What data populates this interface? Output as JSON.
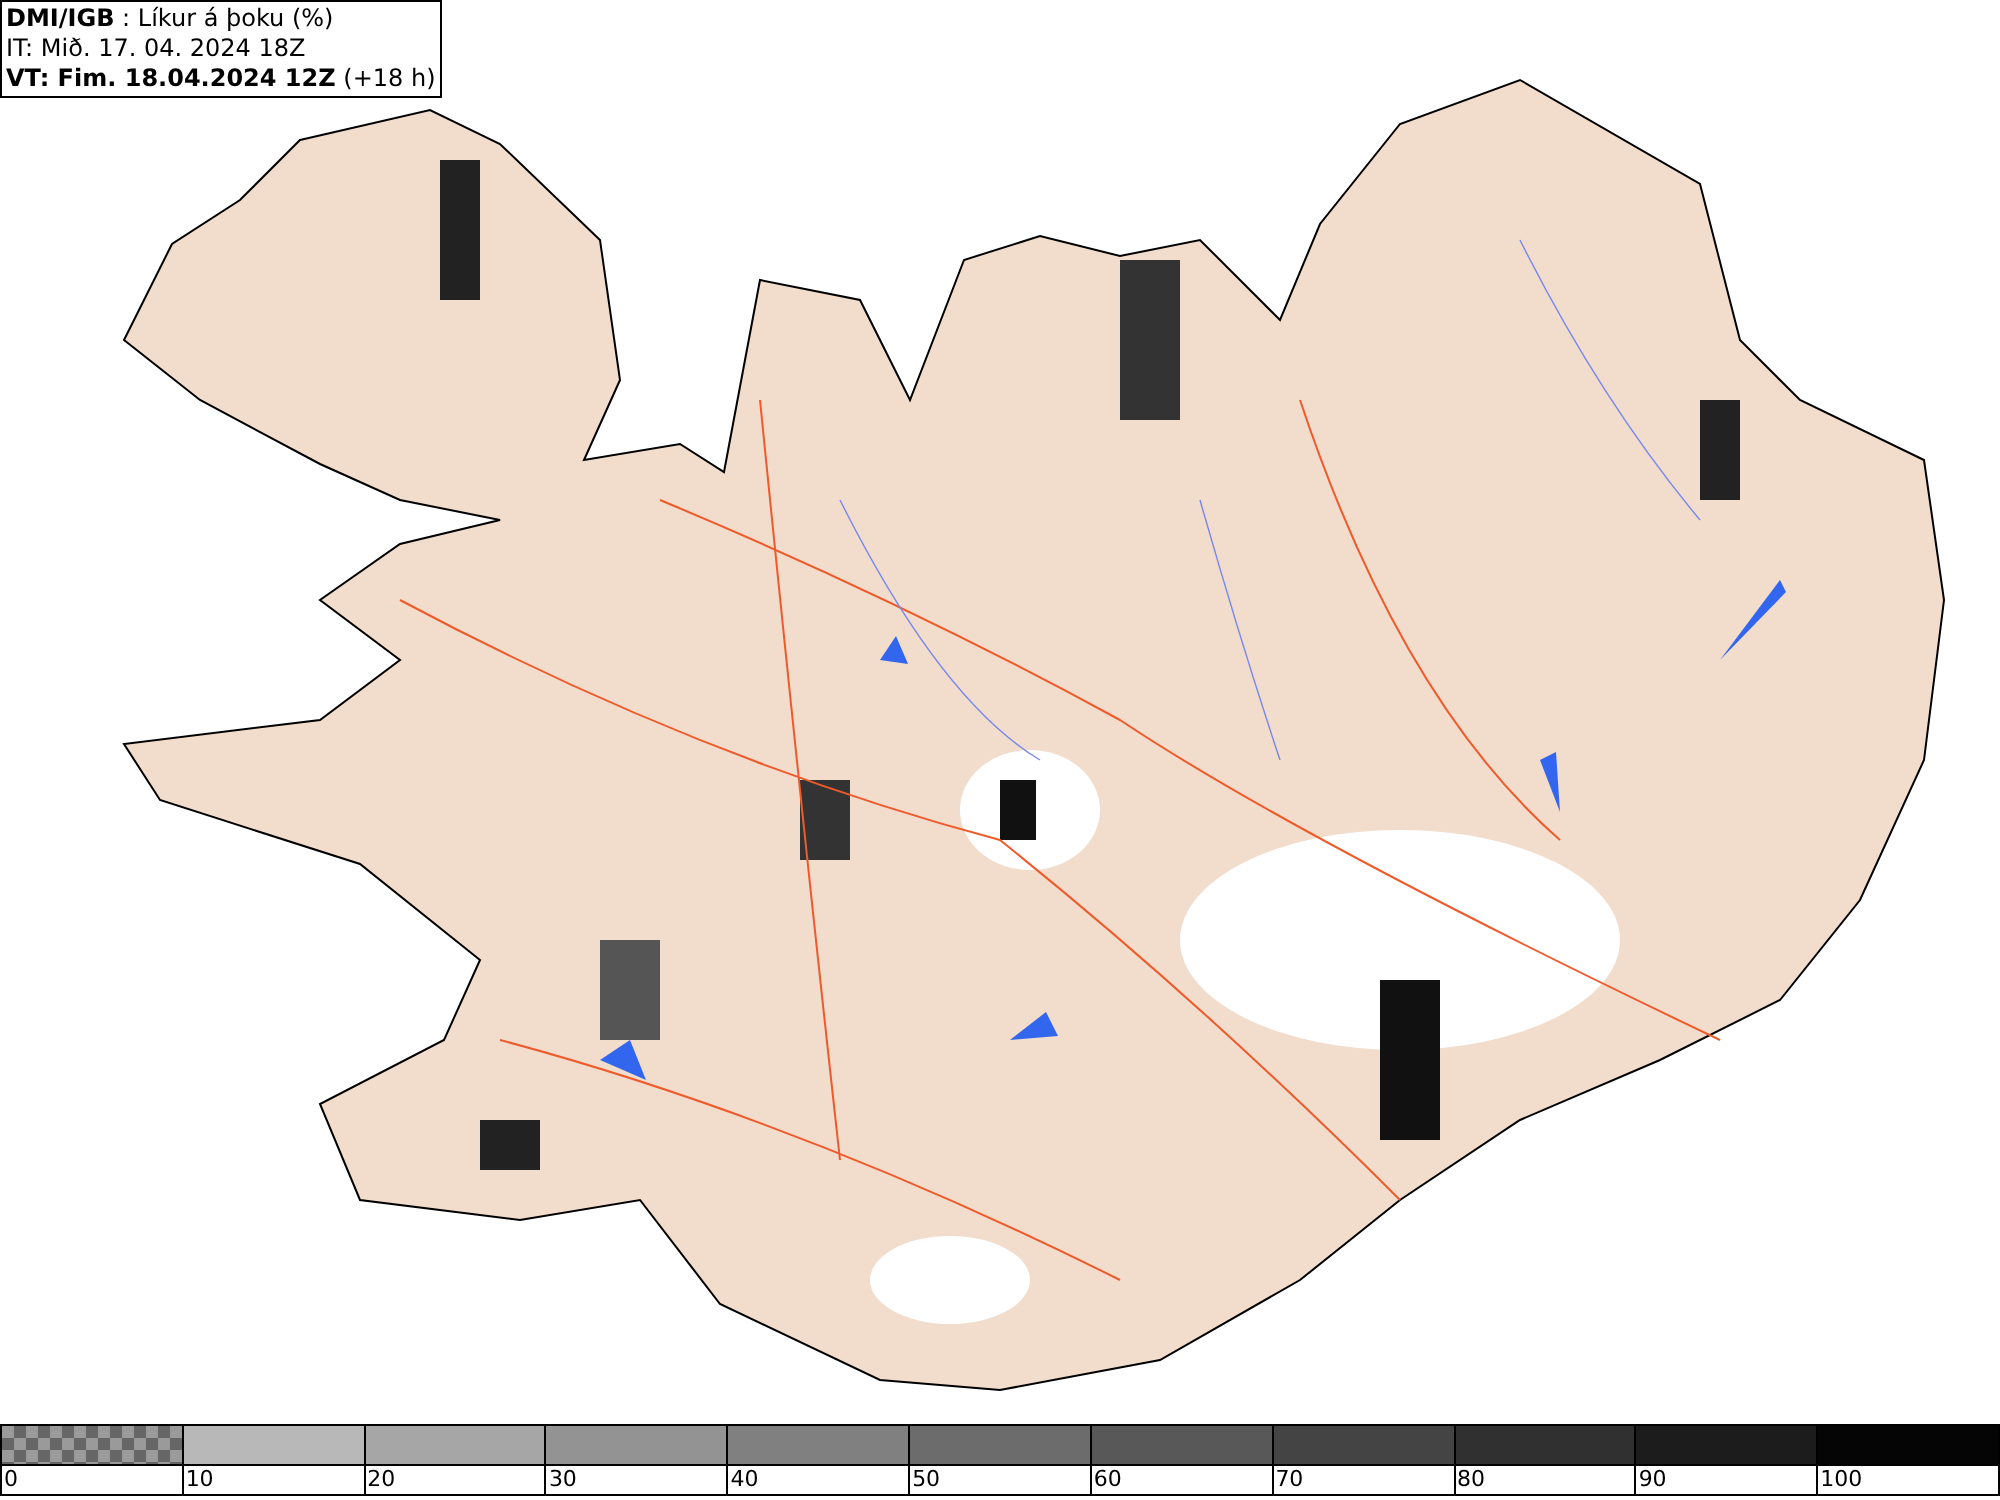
{
  "header": {
    "lines": [
      "**DMI/IGB** : Líkur á þoku (%)",
      "IT: Mið. 17. 04. 2024 18Z",
      "**VT: Fim. 18.04.2024 12Z** (+18 h)"
    ]
  },
  "legend": {
    "segments": [
      {
        "label": "0",
        "color": "#9a9a9a",
        "kind": "checkered"
      },
      {
        "label": "10",
        "color": "#b8b8b8",
        "kind": "solid"
      },
      {
        "label": "20",
        "color": "#a6a6a6",
        "kind": "solid"
      },
      {
        "label": "30",
        "color": "#939393",
        "kind": "solid"
      },
      {
        "label": "40",
        "color": "#808080",
        "kind": "solid"
      },
      {
        "label": "50",
        "color": "#6c6c6c",
        "kind": "solid"
      },
      {
        "label": "60",
        "color": "#585858",
        "kind": "solid"
      },
      {
        "label": "70",
        "color": "#444444",
        "kind": "solid"
      },
      {
        "label": "80",
        "color": "#303030",
        "kind": "solid"
      },
      {
        "label": "90",
        "color": "#1c1c1c",
        "kind": "solid"
      },
      {
        "label": "100",
        "color": "#050505",
        "kind": "solid"
      }
    ]
  }
}
